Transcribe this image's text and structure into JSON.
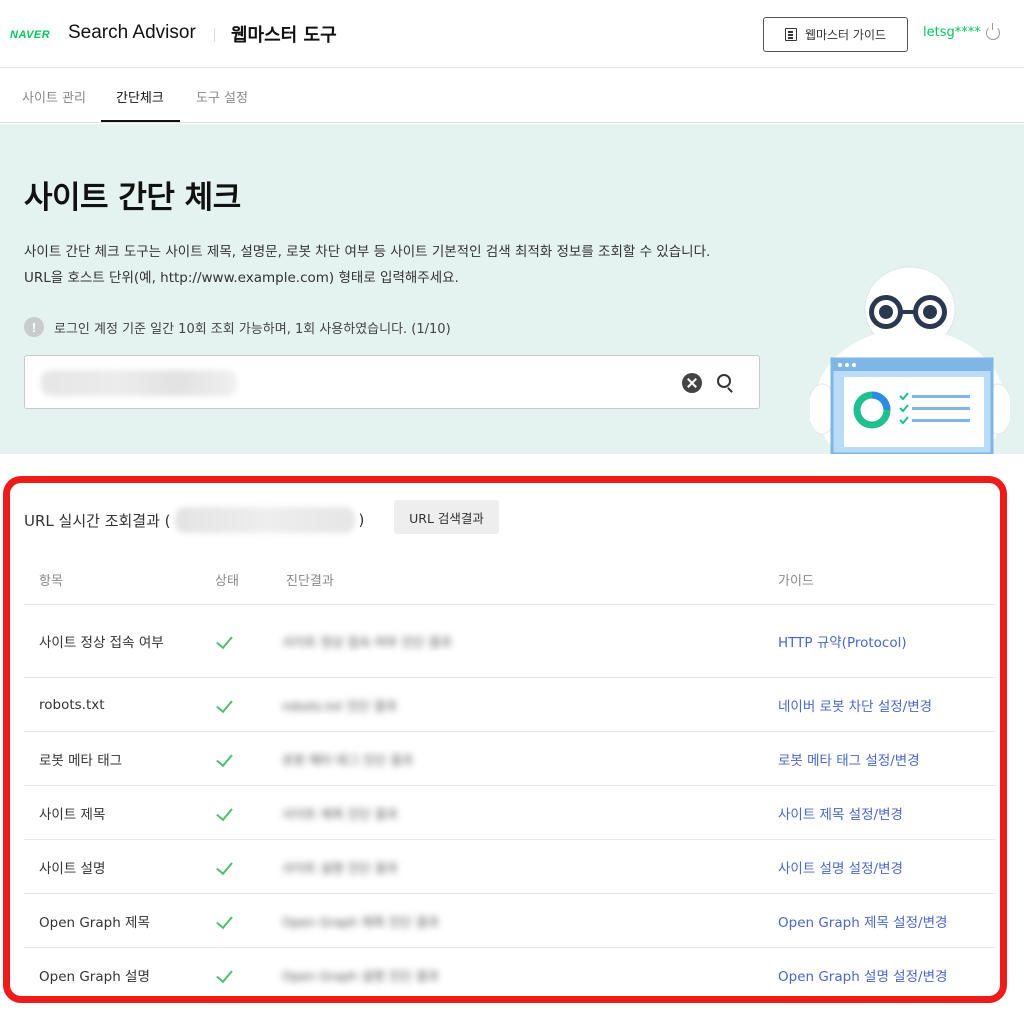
{
  "header": {
    "logo": "NAVER",
    "app_name": "Search Advisor",
    "tool_name": "웹마스터 도구",
    "guide_button": "웹마스터 가이드",
    "user_id": "letsg****"
  },
  "tabs": [
    {
      "label": "사이트 관리",
      "active": false
    },
    {
      "label": "간단체크",
      "active": true
    },
    {
      "label": "도구 설정",
      "active": false
    }
  ],
  "hero": {
    "title": "사이트 간단 체크",
    "desc_line1": "사이트 간단 체크 도구는 사이트 제목, 설명문, 로봇 차단 여부 등 사이트 기본적인 검색 최적화 정보를 조회할 수 있습니다.",
    "desc_line2": "URL을 호스트 단위(예, http://www.example.com) 형태로 입력해주세요.",
    "notice": "로그인 계정 기준 일간 10회 조회 가능하며, 1회 사용하였습니다. (1/10)",
    "search_placeholder": ""
  },
  "result": {
    "title_prefix": "URL 실시간 조회결과 (",
    "title_suffix": ")",
    "url_search_button": "URL 검색결과",
    "columns": [
      "항목",
      "상태",
      "진단결과",
      "가이드"
    ],
    "rows": [
      {
        "item": "사이트 정상 접속 여부",
        "status": "ok",
        "result": "사이트 정상 접속 여부 진단 결과",
        "guide": "HTTP 규약(Protocol)"
      },
      {
        "item": "robots.txt",
        "status": "ok",
        "result": "robots.txt 진단 결과",
        "guide": "네이버 로봇 차단 설정/변경"
      },
      {
        "item": "로봇 메타 태그",
        "status": "ok",
        "result": "로봇 메타 태그 진단 결과",
        "guide": "로봇 메타 태그 설정/변경"
      },
      {
        "item": "사이트 제목",
        "status": "ok",
        "result": "사이트 제목 진단 결과",
        "guide": "사이트 제목 설정/변경"
      },
      {
        "item": "사이트 설명",
        "status": "ok",
        "result": "사이트 설명 진단 결과",
        "guide": "사이트 설명 설정/변경"
      },
      {
        "item": "Open Graph 제목",
        "status": "ok",
        "result": "Open Graph 제목 진단 결과",
        "guide": "Open Graph 제목 설정/변경"
      },
      {
        "item": "Open Graph 설명",
        "status": "ok",
        "result": "Open Graph 설명 진단 결과",
        "guide": "Open Graph 설명 설정/변경"
      }
    ]
  },
  "colors": {
    "brand": "#03c75a",
    "hero_bg": "#e4f2f0",
    "link": "#4a67c9",
    "check": "#4fbf6a",
    "highlight": "#ee1b1b"
  },
  "icons": [
    "doc-icon",
    "power-icon",
    "info-icon",
    "clear-icon",
    "search-icon",
    "check-icon",
    "robot-mascot"
  ]
}
